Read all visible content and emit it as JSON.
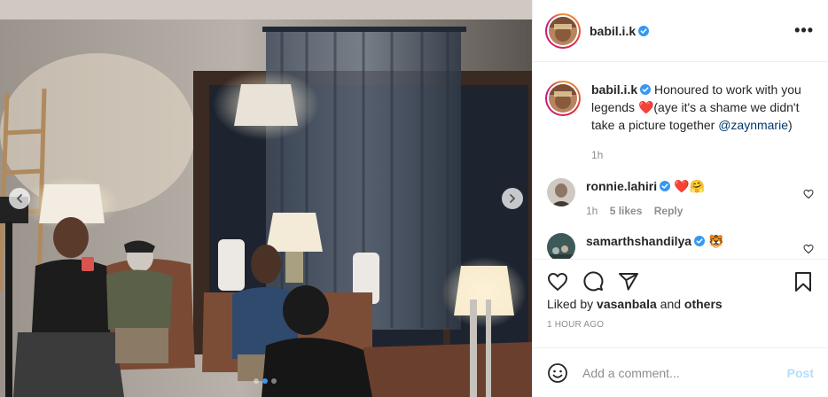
{
  "header": {
    "username": "babil.i.k",
    "more_label": "•••"
  },
  "caption": {
    "username": "babil.i.k",
    "text_before": "Honoured to work with you legends",
    "text_emoji": "❤️",
    "text_after": "(aye it's a shame we didn't take a picture together ",
    "mention": "@zaynmarie",
    "text_end": ")",
    "time": "1h"
  },
  "comments": [
    {
      "username": "ronnie.lahiri",
      "text": "❤️🤗",
      "time": "1h",
      "likes": "5 likes",
      "reply": "Reply"
    },
    {
      "username": "samarthshandilya",
      "text": "🐯"
    }
  ],
  "likes": {
    "prefix": "Liked by ",
    "user": "vasanbala",
    "middle": " and ",
    "others": "others"
  },
  "timestamp": "1 HOUR AGO",
  "add_comment": {
    "placeholder": "Add a comment...",
    "post_label": "Post"
  },
  "carousel": {
    "slide_count": 3,
    "active_index": 1
  },
  "colors": {
    "accent": "#3897f0",
    "post_disabled": "#b2dffc",
    "heart": "#ed4956"
  }
}
